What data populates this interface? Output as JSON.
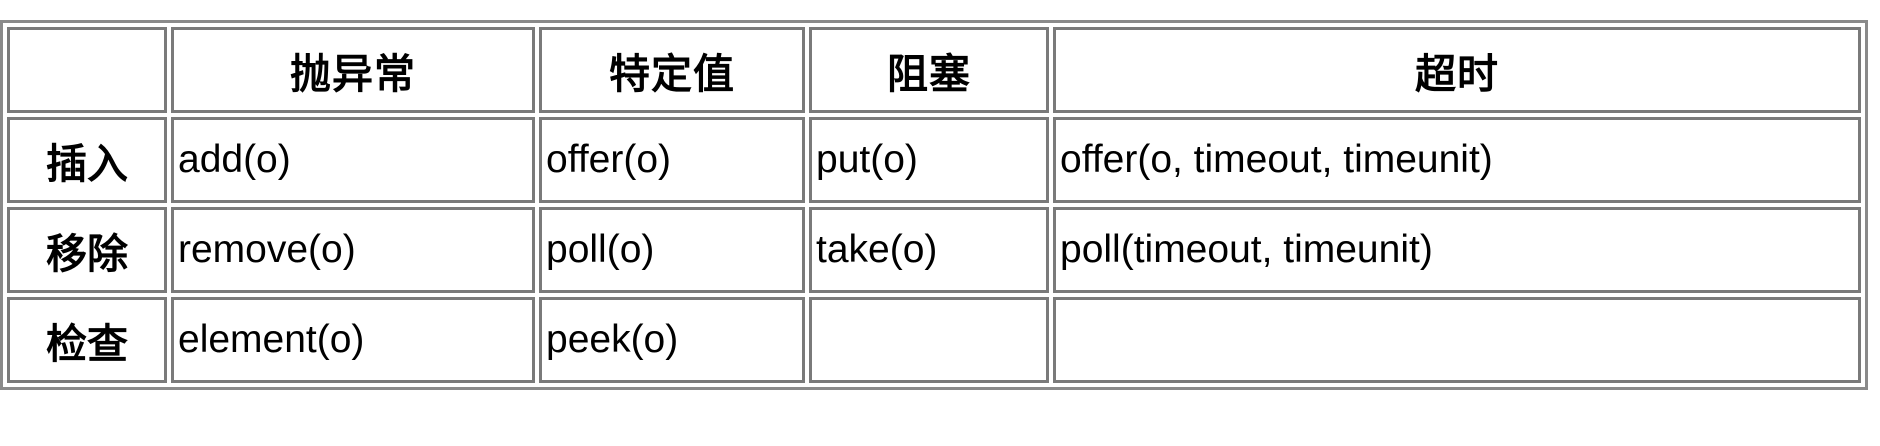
{
  "table": {
    "headers": [
      "",
      "抛异常",
      "特定值",
      "阻塞",
      "超时"
    ],
    "rows": [
      {
        "label": "插入",
        "cells": [
          "add(o)",
          "offer(o)",
          "put(o)",
          "offer(o, timeout, timeunit)"
        ]
      },
      {
        "label": "移除",
        "cells": [
          "remove(o)",
          "poll(o)",
          "take(o)",
          "poll(timeout, timeunit)"
        ]
      },
      {
        "label": "检查",
        "cells": [
          "element(o)",
          "peek(o)",
          "",
          ""
        ]
      }
    ]
  }
}
